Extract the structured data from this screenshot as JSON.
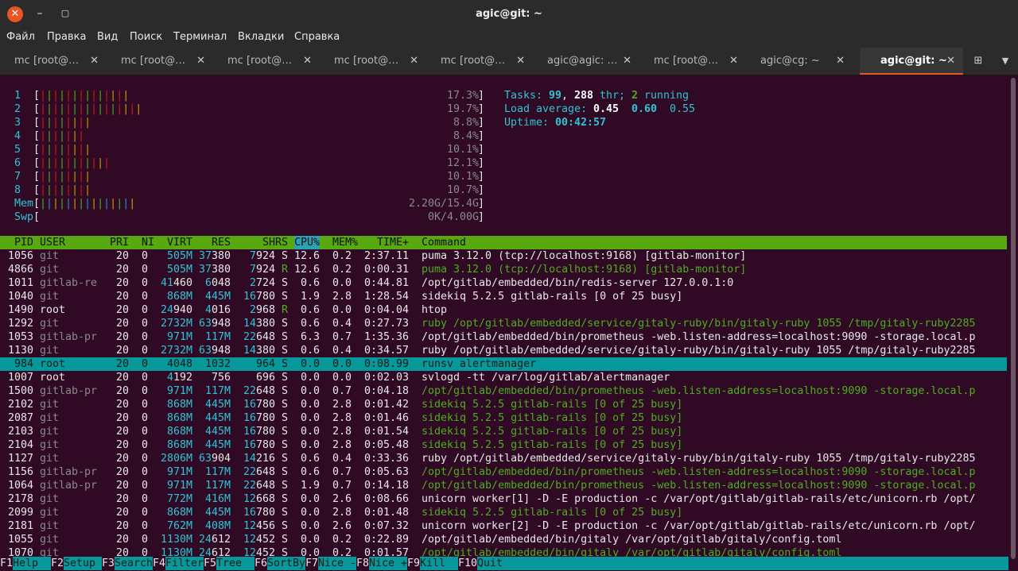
{
  "window": {
    "title": "agic@git: ~"
  },
  "menu": [
    "Файл",
    "Правка",
    "Вид",
    "Поиск",
    "Терминал",
    "Вкладки",
    "Справка"
  ],
  "tabs": [
    {
      "label": "mc [root@…",
      "active": false
    },
    {
      "label": "mc [root@…",
      "active": false
    },
    {
      "label": "mc [root@…",
      "active": false
    },
    {
      "label": "mc [root@…",
      "active": false
    },
    {
      "label": "mc [root@…",
      "active": false
    },
    {
      "label": "agic@agic: …",
      "active": false
    },
    {
      "label": "mc [root@…",
      "active": false
    },
    {
      "label": "agic@cg: ~",
      "active": false
    },
    {
      "label": "agic@git: ~",
      "active": true
    }
  ],
  "meters": [
    {
      "label": "1",
      "bars": "||||||||||||||",
      "value": "17.3%"
    },
    {
      "label": "2",
      "bars": "||||||||||||||||",
      "value": "19.7%"
    },
    {
      "label": "3",
      "bars": "||||||||",
      "value": "8.8%"
    },
    {
      "label": "4",
      "bars": "|||||||",
      "value": "8.4%"
    },
    {
      "label": "5",
      "bars": "||||||||",
      "value": "10.1%"
    },
    {
      "label": "6",
      "bars": "|||||||||||",
      "value": "12.1%"
    },
    {
      "label": "7",
      "bars": "||||||||",
      "value": "10.1%"
    },
    {
      "label": "8",
      "bars": "||||||||",
      "value": "10.7%"
    },
    {
      "label": "Mem",
      "bars": "|||||||||||||||",
      "value": "2.20G/15.4G"
    },
    {
      "label": "Swp",
      "bars": "",
      "value": "0K/4.00G"
    }
  ],
  "summary": {
    "tasks_label": "Tasks:",
    "tasks": "99",
    "thr": "288",
    "thr_label": "thr;",
    "running": "2",
    "running_label": "running",
    "load_label": "Load average:",
    "load1": "0.45",
    "load5": "0.60",
    "load15": "0.55",
    "uptime_label": "Uptime:",
    "uptime": "00:42:57"
  },
  "columns": [
    "PID",
    "USER",
    "PRI",
    "NI",
    "VIRT",
    "RES",
    "SHR",
    "S",
    "CPU%",
    "MEM%",
    "TIME+",
    "Command"
  ],
  "processes": [
    {
      "pid": "1056",
      "user": "git",
      "pri": "20",
      "ni": "0",
      "virt": "505M",
      "res": "37380",
      "shr": "7924",
      "s": "S",
      "cpu": "12.6",
      "mem": "0.2",
      "time": "2:37.11",
      "cmd": "puma 3.12.0 (tcp://localhost:9168) [gitlab-monitor]",
      "thread": false
    },
    {
      "pid": "4866",
      "user": "git",
      "pri": "20",
      "ni": "0",
      "virt": "505M",
      "res": "37380",
      "shr": "7924",
      "s": "R",
      "cpu": "12.6",
      "mem": "0.2",
      "time": "0:00.31",
      "cmd": "puma 3.12.0 (tcp://localhost:9168) [gitlab-monitor]",
      "thread": true
    },
    {
      "pid": "1011",
      "user": "gitlab-re",
      "pri": "20",
      "ni": "0",
      "virt": "41460",
      "res": "6048",
      "shr": "2724",
      "s": "S",
      "cpu": "0.6",
      "mem": "0.0",
      "time": "0:44.81",
      "cmd": "/opt/gitlab/embedded/bin/redis-server 127.0.0.1:0",
      "thread": false
    },
    {
      "pid": "1040",
      "user": "git",
      "pri": "20",
      "ni": "0",
      "virt": "868M",
      "res": "445M",
      "shr": "16780",
      "s": "S",
      "cpu": "1.9",
      "mem": "2.8",
      "time": "1:28.54",
      "cmd": "sidekiq 5.2.5 gitlab-rails [0 of 25 busy]",
      "thread": false
    },
    {
      "pid": "1490",
      "user": "root",
      "pri": "20",
      "ni": "0",
      "virt": "24940",
      "res": "4016",
      "shr": "2968",
      "s": "R",
      "cpu": "0.6",
      "mem": "0.0",
      "time": "0:04.04",
      "cmd": "htop",
      "thread": false
    },
    {
      "pid": "1292",
      "user": "git",
      "pri": "20",
      "ni": "0",
      "virt": "2732M",
      "res": "63948",
      "shr": "14380",
      "s": "S",
      "cpu": "0.6",
      "mem": "0.4",
      "time": "0:27.73",
      "cmd": "ruby /opt/gitlab/embedded/service/gitaly-ruby/bin/gitaly-ruby 1055 /tmp/gitaly-ruby2285",
      "thread": true
    },
    {
      "pid": "1053",
      "user": "gitlab-pr",
      "pri": "20",
      "ni": "0",
      "virt": "971M",
      "res": "117M",
      "shr": "22648",
      "s": "S",
      "cpu": "6.3",
      "mem": "0.7",
      "time": "1:35.36",
      "cmd": "/opt/gitlab/embedded/bin/prometheus -web.listen-address=localhost:9090 -storage.local.p",
      "thread": false
    },
    {
      "pid": "1130",
      "user": "git",
      "pri": "20",
      "ni": "0",
      "virt": "2732M",
      "res": "63948",
      "shr": "14380",
      "s": "S",
      "cpu": "0.6",
      "mem": "0.4",
      "time": "0:34.57",
      "cmd": "ruby /opt/gitlab/embedded/service/gitaly-ruby/bin/gitaly-ruby 1055 /tmp/gitaly-ruby2285",
      "thread": false
    },
    {
      "pid": "984",
      "user": "root",
      "pri": "20",
      "ni": "0",
      "virt": "4048",
      "res": "1032",
      "shr": "964",
      "s": "S",
      "cpu": "0.0",
      "mem": "0.0",
      "time": "0:08.99",
      "cmd": "runsv alertmanager",
      "thread": false,
      "selected": true
    },
    {
      "pid": "1007",
      "user": "root",
      "pri": "20",
      "ni": "0",
      "virt": "4192",
      "res": "756",
      "shr": "696",
      "s": "S",
      "cpu": "0.0",
      "mem": "0.0",
      "time": "0:02.03",
      "cmd": "svlogd -tt /var/log/gitlab/alertmanager",
      "thread": false
    },
    {
      "pid": "1500",
      "user": "gitlab-pr",
      "pri": "20",
      "ni": "0",
      "virt": "971M",
      "res": "117M",
      "shr": "22648",
      "s": "S",
      "cpu": "0.0",
      "mem": "0.7",
      "time": "0:04.18",
      "cmd": "/opt/gitlab/embedded/bin/prometheus -web.listen-address=localhost:9090 -storage.local.p",
      "thread": true
    },
    {
      "pid": "2102",
      "user": "git",
      "pri": "20",
      "ni": "0",
      "virt": "868M",
      "res": "445M",
      "shr": "16780",
      "s": "S",
      "cpu": "0.0",
      "mem": "2.8",
      "time": "0:01.42",
      "cmd": "sidekiq 5.2.5 gitlab-rails [0 of 25 busy]",
      "thread": true
    },
    {
      "pid": "2087",
      "user": "git",
      "pri": "20",
      "ni": "0",
      "virt": "868M",
      "res": "445M",
      "shr": "16780",
      "s": "S",
      "cpu": "0.0",
      "mem": "2.8",
      "time": "0:01.46",
      "cmd": "sidekiq 5.2.5 gitlab-rails [0 of 25 busy]",
      "thread": true
    },
    {
      "pid": "2103",
      "user": "git",
      "pri": "20",
      "ni": "0",
      "virt": "868M",
      "res": "445M",
      "shr": "16780",
      "s": "S",
      "cpu": "0.0",
      "mem": "2.8",
      "time": "0:01.54",
      "cmd": "sidekiq 5.2.5 gitlab-rails [0 of 25 busy]",
      "thread": true
    },
    {
      "pid": "2104",
      "user": "git",
      "pri": "20",
      "ni": "0",
      "virt": "868M",
      "res": "445M",
      "shr": "16780",
      "s": "S",
      "cpu": "0.0",
      "mem": "2.8",
      "time": "0:05.48",
      "cmd": "sidekiq 5.2.5 gitlab-rails [0 of 25 busy]",
      "thread": true
    },
    {
      "pid": "1127",
      "user": "git",
      "pri": "20",
      "ni": "0",
      "virt": "2806M",
      "res": "63904",
      "shr": "14216",
      "s": "S",
      "cpu": "0.6",
      "mem": "0.4",
      "time": "0:33.36",
      "cmd": "ruby /opt/gitlab/embedded/service/gitaly-ruby/bin/gitaly-ruby 1055 /tmp/gitaly-ruby2285",
      "thread": false
    },
    {
      "pid": "1156",
      "user": "gitlab-pr",
      "pri": "20",
      "ni": "0",
      "virt": "971M",
      "res": "117M",
      "shr": "22648",
      "s": "S",
      "cpu": "0.6",
      "mem": "0.7",
      "time": "0:05.63",
      "cmd": "/opt/gitlab/embedded/bin/prometheus -web.listen-address=localhost:9090 -storage.local.p",
      "thread": true
    },
    {
      "pid": "1064",
      "user": "gitlab-pr",
      "pri": "20",
      "ni": "0",
      "virt": "971M",
      "res": "117M",
      "shr": "22648",
      "s": "S",
      "cpu": "1.9",
      "mem": "0.7",
      "time": "0:14.18",
      "cmd": "/opt/gitlab/embedded/bin/prometheus -web.listen-address=localhost:9090 -storage.local.p",
      "thread": true
    },
    {
      "pid": "2178",
      "user": "git",
      "pri": "20",
      "ni": "0",
      "virt": "772M",
      "res": "416M",
      "shr": "12668",
      "s": "S",
      "cpu": "0.0",
      "mem": "2.6",
      "time": "0:08.66",
      "cmd": "unicorn worker[1] -D -E production -c /var/opt/gitlab/gitlab-rails/etc/unicorn.rb /opt/",
      "thread": false
    },
    {
      "pid": "2099",
      "user": "git",
      "pri": "20",
      "ni": "0",
      "virt": "868M",
      "res": "445M",
      "shr": "16780",
      "s": "S",
      "cpu": "0.0",
      "mem": "2.8",
      "time": "0:01.48",
      "cmd": "sidekiq 5.2.5 gitlab-rails [0 of 25 busy]",
      "thread": true
    },
    {
      "pid": "2181",
      "user": "git",
      "pri": "20",
      "ni": "0",
      "virt": "762M",
      "res": "408M",
      "shr": "12456",
      "s": "S",
      "cpu": "0.0",
      "mem": "2.6",
      "time": "0:07.32",
      "cmd": "unicorn worker[2] -D -E production -c /var/opt/gitlab/gitlab-rails/etc/unicorn.rb /opt/",
      "thread": false
    },
    {
      "pid": "1055",
      "user": "git",
      "pri": "20",
      "ni": "0",
      "virt": "1130M",
      "res": "24612",
      "shr": "12452",
      "s": "S",
      "cpu": "0.0",
      "mem": "0.2",
      "time": "0:22.89",
      "cmd": "/opt/gitlab/embedded/bin/gitaly /var/opt/gitlab/gitaly/config.toml",
      "thread": false
    },
    {
      "pid": "1070",
      "user": "git",
      "pri": "20",
      "ni": "0",
      "virt": "1130M",
      "res": "24612",
      "shr": "12452",
      "s": "S",
      "cpu": "0.0",
      "mem": "0.2",
      "time": "0:01.57",
      "cmd": "/opt/gitlab/embedded/bin/gitaly /var/opt/gitlab/gitaly/config.toml",
      "thread": true
    }
  ],
  "function_keys": [
    {
      "key": "F1",
      "label": "Help"
    },
    {
      "key": "F2",
      "label": "Setup"
    },
    {
      "key": "F3",
      "label": "Search"
    },
    {
      "key": "F4",
      "label": "Filter"
    },
    {
      "key": "F5",
      "label": "Tree"
    },
    {
      "key": "F6",
      "label": "SortBy"
    },
    {
      "key": "F7",
      "label": "Nice -"
    },
    {
      "key": "F8",
      "label": "Nice +"
    },
    {
      "key": "F9",
      "label": "Kill"
    },
    {
      "key": "F10",
      "label": "Quit"
    }
  ]
}
